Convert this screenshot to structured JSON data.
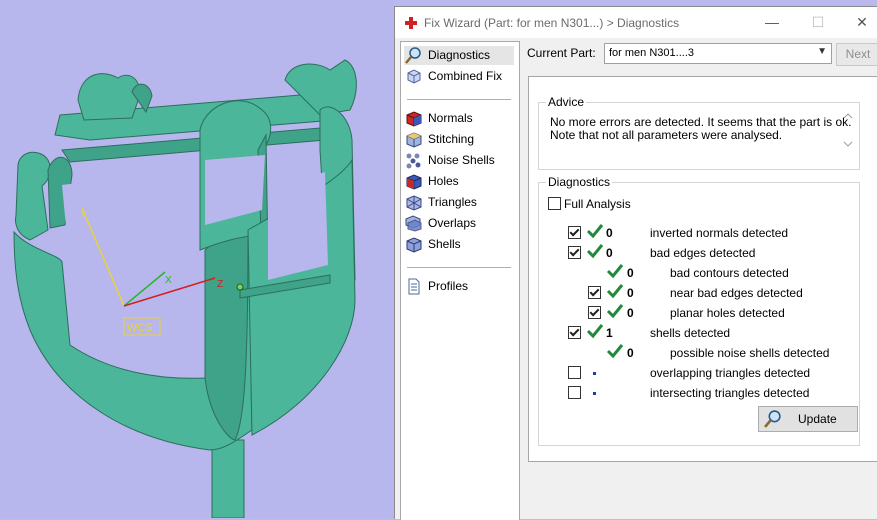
{
  "viewport": {
    "axis_y": "Y",
    "axis_x": "X",
    "axis_z": "Z",
    "wcs_label": "WCS",
    "model_color": "#4bb69a",
    "background_color": "#b7b7ee"
  },
  "window": {
    "title": "Fix Wizard (Part: for men N301...) > Diagnostics",
    "minimize_glyph": "—",
    "maximize_glyph": "☐",
    "close_glyph": "✕"
  },
  "sidebar": {
    "items": [
      {
        "label": "Diagnostics",
        "icon": "magnifier-icon",
        "selected": true
      },
      {
        "label": "Combined Fix",
        "icon": "combined-fix-icon"
      },
      {
        "label": "Normals",
        "icon": "normals-cube-icon"
      },
      {
        "label": "Stitching",
        "icon": "stitching-cube-icon"
      },
      {
        "label": "Noise Shells",
        "icon": "noise-shells-icon"
      },
      {
        "label": "Holes",
        "icon": "holes-cube-icon"
      },
      {
        "label": "Triangles",
        "icon": "triangles-icon"
      },
      {
        "label": "Overlaps",
        "icon": "overlaps-icon"
      },
      {
        "label": "Shells",
        "icon": "shells-icon"
      },
      {
        "label": "Profiles",
        "icon": "document-icon"
      }
    ]
  },
  "main": {
    "current_part_label": "Current Part:",
    "current_part_value": "for men N301....3",
    "next_label": "Next",
    "advice": {
      "title": "Advice",
      "line1": "No more errors are detected. It seems that the part is ok.",
      "line2": "Note that not all parameters were analysed."
    },
    "diagnostics": {
      "title": "Diagnostics",
      "full_analysis_label": "Full Analysis",
      "rows": [
        {
          "checkbox": true,
          "status": "ok",
          "value": "0",
          "label": "inverted normals detected"
        },
        {
          "checkbox": true,
          "status": "ok",
          "value": "0",
          "label": "bad edges detected"
        },
        {
          "checkbox": null,
          "status": "ok",
          "value": "0",
          "label": "bad contours detected"
        },
        {
          "checkbox": true,
          "status": "ok",
          "value": "0",
          "label": "near bad edges detected"
        },
        {
          "checkbox": true,
          "status": "ok",
          "value": "0",
          "label": "planar holes detected"
        },
        {
          "checkbox": true,
          "status": "ok",
          "value": "1",
          "label": "shells detected"
        },
        {
          "checkbox": null,
          "status": "ok",
          "value": "0",
          "label": "possible noise shells detected"
        },
        {
          "checkbox": false,
          "status": "none",
          "value": "",
          "label": "overlapping triangles detected"
        },
        {
          "checkbox": false,
          "status": "none",
          "value": "",
          "label": "intersecting triangles detected"
        }
      ],
      "update_label": "Update"
    }
  },
  "colors": {
    "check_green": "#1f8a3a",
    "dot_blue": "#1a3fa0"
  }
}
